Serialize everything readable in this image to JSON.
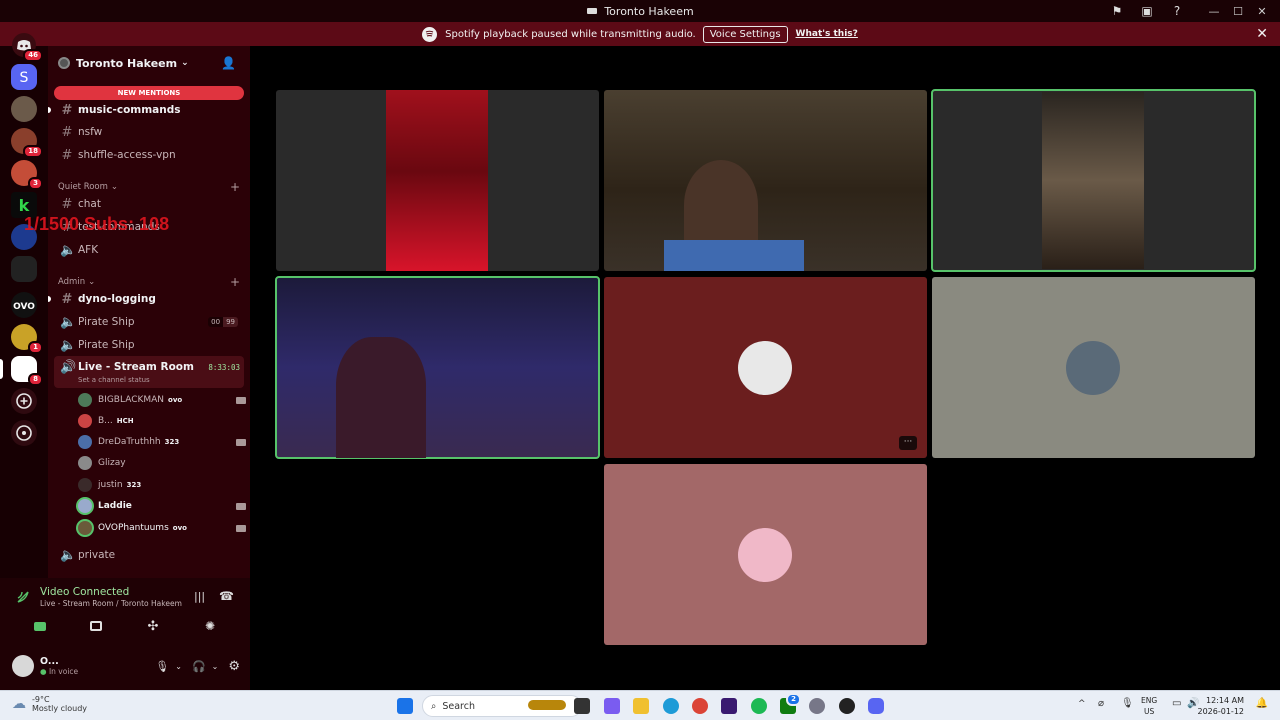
{
  "window": {
    "title": "Toronto Hakeem"
  },
  "notice": {
    "message": "Spotify playback paused while transmitting audio.",
    "button_label": "Voice Settings",
    "link_label": "What's this?"
  },
  "rail": {
    "home_badge": "46",
    "badges": [
      "18",
      "3",
      "1",
      "8"
    ]
  },
  "server": {
    "name": "Toronto Hakeem",
    "new_mentions": "NEW MENTIONS"
  },
  "channels": {
    "top": [
      {
        "name": "music-commands",
        "unread": true
      },
      {
        "name": "nsfw",
        "unread": false
      },
      {
        "name": "shuffle-access-vpn",
        "unread": false
      }
    ],
    "quiet_category": "Quiet Room",
    "quiet": [
      {
        "name": "chat"
      },
      {
        "name": "test-commands"
      },
      {
        "name": "AFK"
      }
    ],
    "admin_category": "Admin",
    "admin": [
      {
        "name": "dyno-logging"
      },
      {
        "name": "Pirate Ship"
      },
      {
        "name": "Pirate Ship"
      }
    ],
    "pirate_counts": [
      "00",
      "99"
    ],
    "live_room": "Live - Stream Room",
    "live_timer": "8:33:03",
    "live_status": "Set a channel status",
    "private": "private"
  },
  "voice_users": [
    {
      "name": "BIGBLACKMAN",
      "tag": "ovo",
      "camera": true
    },
    {
      "name": "B...",
      "tag": "HCH",
      "camera": false
    },
    {
      "name": "DreDaTruthhh",
      "tag": "323",
      "camera": true
    },
    {
      "name": "Glizay",
      "tag": "",
      "camera": false
    },
    {
      "name": "justin",
      "tag": "323",
      "camera": false
    },
    {
      "name": "Laddie",
      "tag": "",
      "camera": true
    },
    {
      "name": "OVOPhantuums",
      "tag": "ovo",
      "camera": true
    }
  ],
  "overlay_text": "1/1500 Subs: 108",
  "voice_panel": {
    "status": "Video Connected",
    "location": "Live - Stream Room / Toronto Hakeem",
    "user_name": "O...",
    "user_status": "In voice"
  },
  "taskbar": {
    "temperature": "-9°C",
    "weather": "Mostly cloudy",
    "search_placeholder": "Search",
    "lang_top": "ENG",
    "lang_bottom": "US",
    "time": "12:14 AM",
    "date": "2026-01-12",
    "notif_badge": "2"
  },
  "colors": {
    "accent_red": "#e0343f",
    "speaking_green": "#57c36a",
    "sidebar": "#2b0107",
    "notice": "#5c0a16"
  }
}
